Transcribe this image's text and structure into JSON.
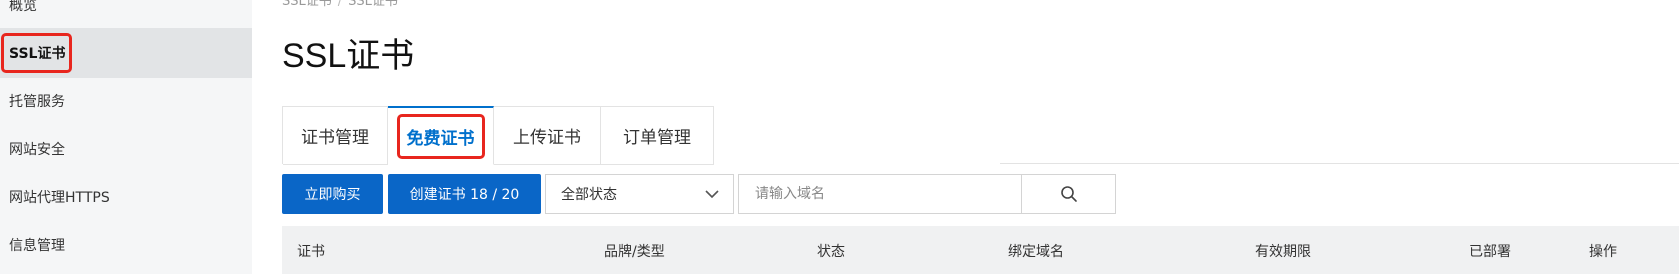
{
  "sidebar": {
    "items": [
      {
        "label": "概览",
        "active": false
      },
      {
        "label": "SSL证书",
        "active": true
      },
      {
        "label": "托管服务",
        "active": false
      },
      {
        "label": "网站安全",
        "active": false
      },
      {
        "label": "网站代理HTTPS",
        "active": false
      },
      {
        "label": "信息管理",
        "active": false
      }
    ]
  },
  "breadcrumb": {
    "items": [
      "SSL证书",
      "SSL证书"
    ],
    "separator": "/"
  },
  "page": {
    "title": "SSL证书"
  },
  "tabs": [
    {
      "label": "证书管理",
      "active": false
    },
    {
      "label": "免费证书",
      "active": true
    },
    {
      "label": "上传证书",
      "active": false
    },
    {
      "label": "订单管理",
      "active": false
    }
  ],
  "toolbar": {
    "buy_label": "立即购买",
    "create_label": "创建证书 18 / 20",
    "status_select": {
      "value": "全部状态",
      "icon": "chevron-down-icon"
    },
    "search": {
      "placeholder": "请输入域名",
      "value": "",
      "icon": "search-icon"
    }
  },
  "table": {
    "columns": [
      "证书",
      "品牌/类型",
      "状态",
      "绑定域名",
      "有效期限",
      "已部署",
      "操作"
    ]
  },
  "colors": {
    "primary": "#0a66c7",
    "active_tab": "#0070cc",
    "highlight_box": "#e8261e",
    "sidebar_bg": "#f5f6f7",
    "table_header_bg": "#f0f1f2"
  }
}
